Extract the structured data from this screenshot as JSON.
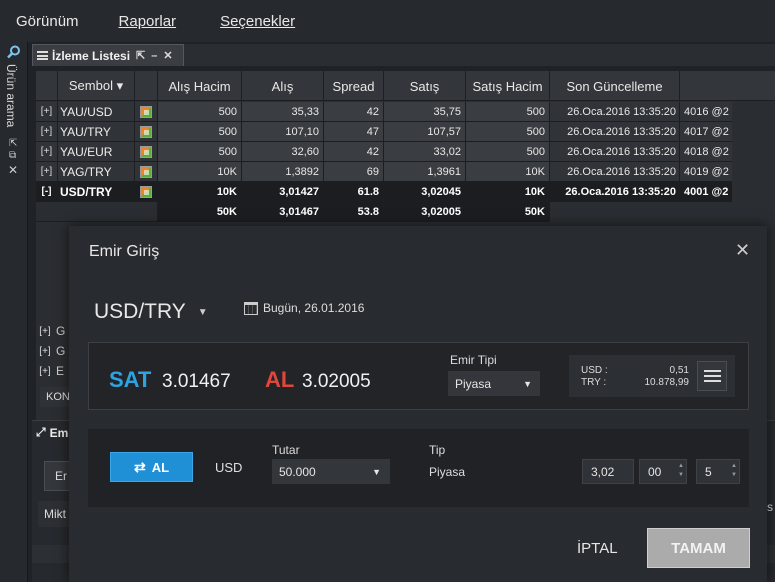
{
  "menu": {
    "view": "Görünüm",
    "reports": "Raporlar",
    "options": "Seçenekler"
  },
  "left_strip": {
    "search_label": "Ürün arama",
    "pin": "⇱",
    "pop": "⧉",
    "close": "✕"
  },
  "watchlist": {
    "tab_title": "İzleme Listesi",
    "tab_btn1": "⇱",
    "tab_btn2": "–",
    "tab_btn3": "✕",
    "columns": [
      "Sembol ▾",
      "Alış Hacim",
      "Alış",
      "Spread",
      "Satış",
      "Satış Hacim",
      "Son Güncelleme"
    ],
    "rows": [
      {
        "exp": "[+]",
        "sym": "YAU/USD",
        "bidvol": "500",
        "bid": "35,33",
        "spread": "42",
        "ask": "35,75",
        "askvol": "500",
        "date": "26.Oca.2016 13:35:20",
        "extra": "4016 @2"
      },
      {
        "exp": "[+]",
        "sym": "YAU/TRY",
        "bidvol": "500",
        "bid": "107,10",
        "spread": "47",
        "ask": "107,57",
        "askvol": "500",
        "date": "26.Oca.2016 13:35:20",
        "extra": "4017 @2"
      },
      {
        "exp": "[+]",
        "sym": "YAU/EUR",
        "bidvol": "500",
        "bid": "32,60",
        "spread": "42",
        "ask": "33,02",
        "askvol": "500",
        "date": "26.Oca.2016 13:35:20",
        "extra": "4018 @2"
      },
      {
        "exp": "[+]",
        "sym": "YAG/TRY",
        "bidvol": "10K",
        "bid": "1,3892",
        "spread": "69",
        "ask": "1,3961",
        "askvol": "10K",
        "date": "26.Oca.2016 13:35:20",
        "extra": "4019 @2"
      },
      {
        "exp": "[-]",
        "sym": "USD/TRY",
        "bidvol": "10K",
        "bid": "3,01427",
        "spread": "61.8",
        "ask": "3,02045",
        "askvol": "10K",
        "date": "26.Oca.2016 13:35:20",
        "extra": "4001 @2"
      }
    ],
    "subrow": {
      "bidvol": "50K",
      "bid": "3,01467",
      "spread": "53.8",
      "ask": "3,02005",
      "askvol": "50K"
    },
    "lower_rows": [
      {
        "exp": "[+]",
        "sym": "G"
      },
      {
        "exp": "[+]",
        "sym": "G"
      },
      {
        "exp": "[+]",
        "sym": "E"
      }
    ],
    "kon_label": "KON"
  },
  "panel2": {
    "title": "Em",
    "button": "Er",
    "label": "Mikt"
  },
  "right_cut": "s",
  "modal": {
    "title": "Emir Giriş",
    "close": "✕",
    "symbol": "USD/TRY",
    "date_label": "Bugün,",
    "date": "26.01.2016",
    "sell_label": "SAT",
    "sell_price": "3.01467",
    "buy_label": "AL",
    "buy_price": "3.02005",
    "order_type_label": "Emir Tipi",
    "order_type": "Piyasa",
    "balance": {
      "usd_label": "USD :",
      "usd_value": "0,51",
      "try_label": "TRY :",
      "try_value": "10.878,99"
    },
    "action_button": "AL",
    "currency": "USD",
    "amount_label": "Tutar",
    "amount": "50.000",
    "type_label": "Tip",
    "type_value": "Piyasa",
    "spin1": "3,02",
    "spin2": "00",
    "spin3": "5",
    "cancel": "İPTAL",
    "ok": "TAMAM"
  },
  "colors": {
    "sell": "#2ea3e2",
    "buy": "#e0473a",
    "primary_button": "#1f8fd6"
  }
}
